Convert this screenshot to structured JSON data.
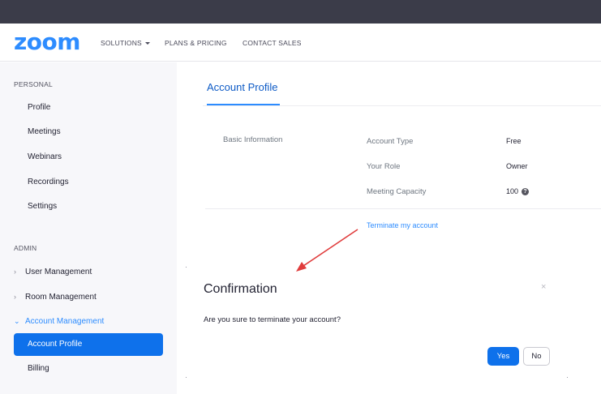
{
  "brand": {
    "logo_text": "zoom",
    "accent_color": "#2d8cff",
    "primary_button_color": "#0e71eb"
  },
  "nav": {
    "solutions": "SOLUTIONS",
    "plans": "PLANS & PRICING",
    "contact": "CONTACT SALES"
  },
  "sidebar": {
    "personal_heading": "PERSONAL",
    "personal_items": [
      "Profile",
      "Meetings",
      "Webinars",
      "Recordings",
      "Settings"
    ],
    "admin_heading": "ADMIN",
    "admin_groups": [
      "User Management",
      "Room Management",
      "Account Management"
    ],
    "active_item": "Account Profile",
    "sub_items": [
      "Billing"
    ]
  },
  "main": {
    "title": "Account Profile",
    "section_label": "Basic Information",
    "fields": [
      {
        "label": "Account Type",
        "value": "Free"
      },
      {
        "label": "Your Role",
        "value": "Owner"
      },
      {
        "label": "Meeting Capacity",
        "value": "100"
      }
    ],
    "terminate_link": "Terminate my account"
  },
  "modal": {
    "title": "Confirmation",
    "close_symbol": "×",
    "message": "Are you sure to terminate your account?",
    "yes_label": "Yes",
    "no_label": "No"
  }
}
